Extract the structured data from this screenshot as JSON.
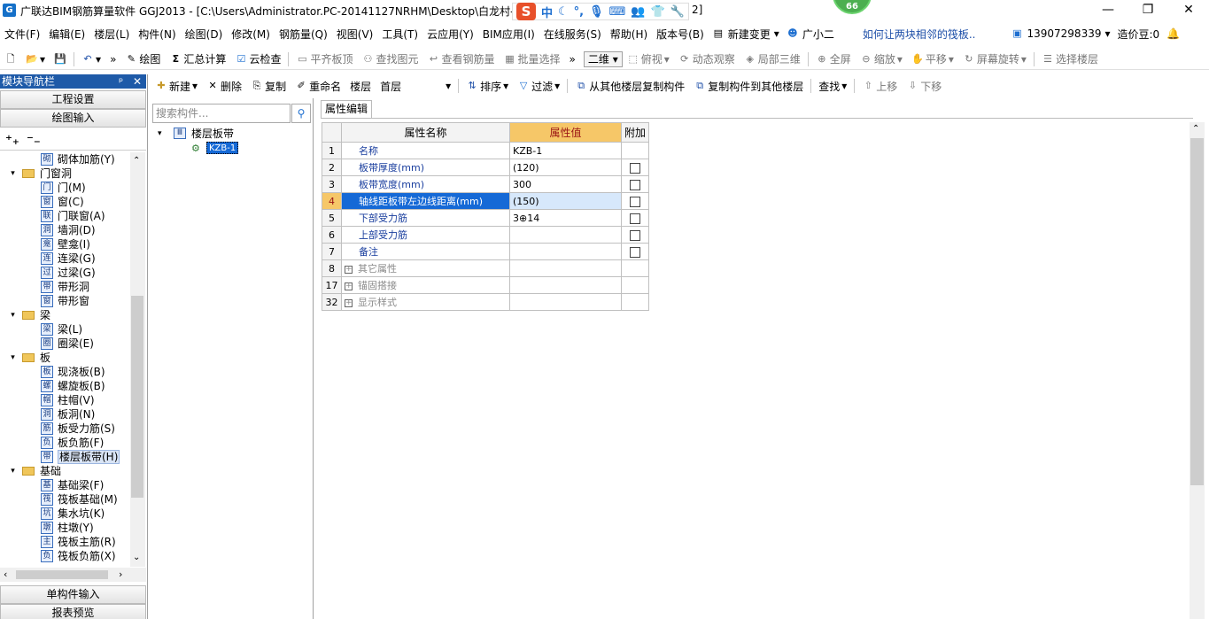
{
  "window": {
    "title": "广联达BIM钢筋算量软件 GGJ2013 - [C:\\Users\\Administrator.PC-20141127NRHM\\Desktop\\白龙村-",
    "title_tail": "2]",
    "app_icon": "G",
    "sogou": {
      "logo": "S",
      "mode": "中"
    },
    "badge": "66",
    "btn_minimize": "—",
    "btn_restore": "❐",
    "btn_close": "✕"
  },
  "menubar": {
    "items": [
      "文件(F)",
      "编辑(E)",
      "楼层(L)",
      "构件(N)",
      "绘图(D)",
      "修改(M)",
      "钢筋量(Q)",
      "视图(V)",
      "工具(T)",
      "云应用(Y)",
      "BIM应用(I)",
      "在线服务(S)",
      "帮助(H)",
      "版本号(B)"
    ],
    "new_change": "新建变更",
    "assistant": "广小二",
    "help_link": "如何让两块相邻的筏板..",
    "phone": "13907298339",
    "price_bean": "造价豆:0"
  },
  "toolbar1": {
    "draw": "绘图",
    "sum": "汇总计算",
    "cloud_check": "云检查",
    "flat_slab": "平齐板顶",
    "find_elem": "查找图元",
    "view_rebar": "查看钢筋量",
    "batch_select": "批量选择",
    "view_2d": "二维",
    "top_view": "俯视",
    "dynamic_view": "动态观察",
    "partial_3d": "局部三维",
    "full_screen": "全屏",
    "zoom": "缩放",
    "pan": "平移",
    "screen_rotate": "屏幕旋转",
    "select_floor": "选择楼层"
  },
  "toolbar2": {
    "new": "新建",
    "delete": "删除",
    "copy": "复制",
    "rename": "重命名",
    "floor_label": "楼层",
    "floor_value": "首层",
    "sort": "排序",
    "filter": "过滤",
    "copy_from": "从其他楼层复制构件",
    "copy_to": "复制构件到其他楼层",
    "find": "查找",
    "move_up": "上移",
    "move_down": "下移"
  },
  "leftpanel": {
    "title": "模块导航栏",
    "pin": "ᵖ",
    "close": "✕",
    "btn_project": "工程设置",
    "btn_draw": "绘图输入",
    "btn_single": "单构件输入",
    "btn_report": "报表预览",
    "tree": [
      {
        "t": "item",
        "label": "砌体加筋(Y)",
        "ic": "砌"
      },
      {
        "t": "group",
        "label": "门窗洞"
      },
      {
        "t": "item",
        "label": "门(M)",
        "ic": "门"
      },
      {
        "t": "item",
        "label": "窗(C)",
        "ic": "窗"
      },
      {
        "t": "item",
        "label": "门联窗(A)",
        "ic": "联"
      },
      {
        "t": "item",
        "label": "墙洞(D)",
        "ic": "洞"
      },
      {
        "t": "item",
        "label": "壁龛(I)",
        "ic": "龛"
      },
      {
        "t": "item",
        "label": "连梁(G)",
        "ic": "连"
      },
      {
        "t": "item",
        "label": "过梁(G)",
        "ic": "过"
      },
      {
        "t": "item",
        "label": "带形洞",
        "ic": "带"
      },
      {
        "t": "item",
        "label": "带形窗",
        "ic": "窗"
      },
      {
        "t": "group",
        "label": "梁"
      },
      {
        "t": "item",
        "label": "梁(L)",
        "ic": "梁"
      },
      {
        "t": "item",
        "label": "圈梁(E)",
        "ic": "圈"
      },
      {
        "t": "group",
        "label": "板"
      },
      {
        "t": "item",
        "label": "现浇板(B)",
        "ic": "板"
      },
      {
        "t": "item",
        "label": "螺旋板(B)",
        "ic": "螺"
      },
      {
        "t": "item",
        "label": "柱帽(V)",
        "ic": "帽"
      },
      {
        "t": "item",
        "label": "板洞(N)",
        "ic": "洞"
      },
      {
        "t": "item",
        "label": "板受力筋(S)",
        "ic": "筋"
      },
      {
        "t": "item",
        "label": "板负筋(F)",
        "ic": "负"
      },
      {
        "t": "item",
        "label": "楼层板带(H)",
        "ic": "带",
        "sel": true
      },
      {
        "t": "group",
        "label": "基础"
      },
      {
        "t": "item",
        "label": "基础梁(F)",
        "ic": "基"
      },
      {
        "t": "item",
        "label": "筏板基础(M)",
        "ic": "筏"
      },
      {
        "t": "item",
        "label": "集水坑(K)",
        "ic": "坑"
      },
      {
        "t": "item",
        "label": "柱墩(Y)",
        "ic": "墩"
      },
      {
        "t": "item",
        "label": "筏板主筋(R)",
        "ic": "主"
      },
      {
        "t": "item",
        "label": "筏板负筋(X)",
        "ic": "负"
      }
    ]
  },
  "midpanel": {
    "search_placeholder": "搜索构件...",
    "root": "楼层板带",
    "child": "KZB-1"
  },
  "propgrid": {
    "tab": "属性编辑",
    "col_num": "",
    "col_name": "属性名称",
    "col_value": "属性值",
    "col_extra": "附加",
    "rows": [
      {
        "n": "1",
        "name": "名称",
        "value": "KZB-1",
        "cb": false
      },
      {
        "n": "2",
        "name": "板带厚度(mm)",
        "value": "(120)",
        "cb": true
      },
      {
        "n": "3",
        "name": "板带宽度(mm)",
        "value": "300",
        "cb": true
      },
      {
        "n": "4",
        "name": "轴线距板带左边线距离(mm)",
        "value": "(150)",
        "cb": true,
        "sel": true
      },
      {
        "n": "5",
        "name": "下部受力筋",
        "value": "3⊕14",
        "cb": true
      },
      {
        "n": "6",
        "name": "上部受力筋",
        "value": "",
        "cb": true
      },
      {
        "n": "7",
        "name": "备注",
        "value": "",
        "cb": true
      },
      {
        "n": "8",
        "name": "其它属性",
        "value": "",
        "group": true
      },
      {
        "n": "17",
        "name": "锚固搭接",
        "value": "",
        "group": true
      },
      {
        "n": "32",
        "name": "显示样式",
        "value": "",
        "group": true
      }
    ]
  }
}
